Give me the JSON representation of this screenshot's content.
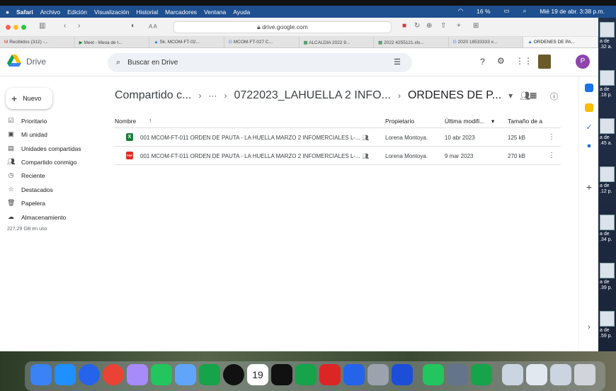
{
  "menubar": {
    "app": "Safari",
    "items": [
      "Archivo",
      "Edición",
      "Visualización",
      "Historial",
      "Marcadores",
      "Ventana",
      "Ayuda"
    ],
    "battery": "16 %",
    "datetime": "Mié 19 de abr. 3:38 p.m."
  },
  "browser": {
    "address": "drive.google.com",
    "tabs": [
      "Recibidos (312) -...",
      "Meet - Mesa de t...",
      "Sk. MCOM-FT-02...",
      "MCOM-FT-027 C...",
      "ALCALDIA 2022 9...",
      "2022 4255121.xls...",
      "2020 18533333 x...",
      "ORDENES DE PA..."
    ]
  },
  "drive": {
    "logo_label": "Drive",
    "search_placeholder": "Buscar en Drive",
    "avatar_initial": "P",
    "new_label": "Nuevo",
    "nav": [
      {
        "label": "Prioritario",
        "icon": "priority-icon"
      },
      {
        "label": "Mi unidad",
        "icon": "my-drive-icon"
      },
      {
        "label": "Unidades compartidas",
        "icon": "shared-drives-icon"
      },
      {
        "label": "Compartido conmigo",
        "icon": "shared-with-me-icon"
      },
      {
        "label": "Reciente",
        "icon": "recent-icon"
      },
      {
        "label": "Destacados",
        "icon": "star-icon"
      },
      {
        "label": "Papelera",
        "icon": "trash-icon"
      },
      {
        "label": "Almacenamiento",
        "icon": "cloud-icon"
      }
    ],
    "storage_used": "227,29 GB en uso",
    "breadcrumb": {
      "first": "Compartido c...",
      "ellipsis": "···",
      "second": "0722023_LAHUELLA 2 INFO...",
      "current": "ORDENES DE P..."
    },
    "columns": {
      "name": "Nombre",
      "owner": "Propietario",
      "modified": "Última modifi...",
      "size": "Tamaño de a"
    },
    "files": [
      {
        "name": "001 MCOM-FT-011 ORDEN DE PAUTA - LA HUELLA MARZO 2 INFOMERCIALES L-...",
        "owner": "Lorena Montoya.",
        "modified": "10 abr 2023",
        "size": "125 kB",
        "type_icon": "excel-file-icon",
        "type_glyph": "X",
        "color": "#188038"
      },
      {
        "name": "001 MCOM-FT-011 ORDEN DE PAUTA - LA HUELLA MARZO 2 INFOMERCIALES L-...",
        "owner": "Lorena Montoya.",
        "modified": "9 mar 2023",
        "size": "270 kB",
        "type_icon": "pdf-file-icon",
        "type_glyph": "PDF",
        "color": "#d93025"
      }
    ]
  },
  "desktop": {
    "thumb_labels": [
      "a de\n.32 a.",
      "a de\n.18 p.",
      "a de\n.45 a.",
      "a de\n.12 p.",
      "a de\n.34 p.",
      "a de\n.39 p.",
      "a de\n.59 p."
    ]
  },
  "dock": {
    "calendar_day": "19"
  }
}
